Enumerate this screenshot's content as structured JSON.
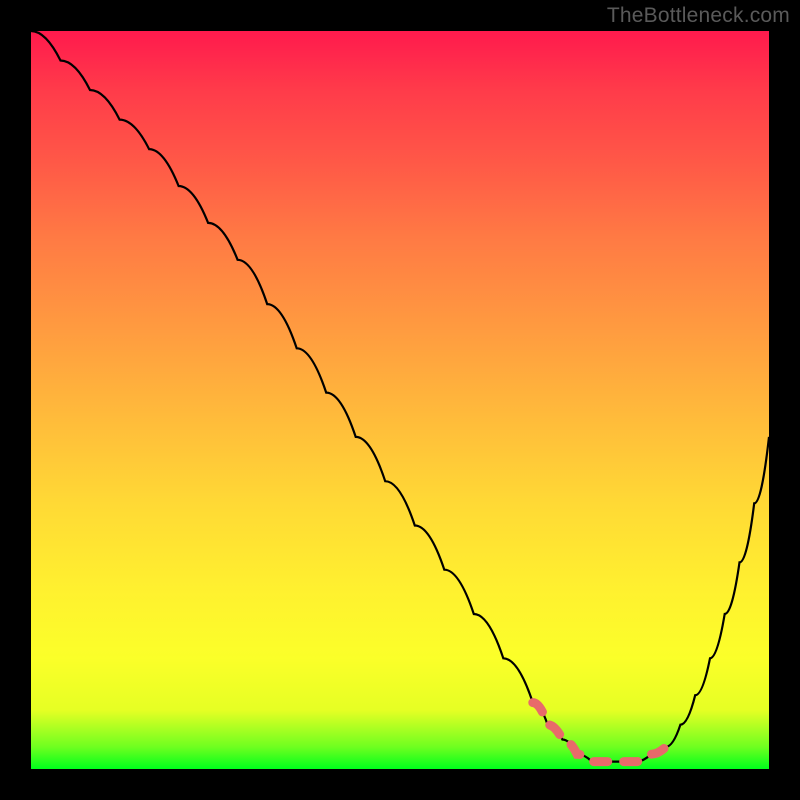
{
  "watermark": "TheBottleneck.com",
  "colors": {
    "frame_bg": "#000000",
    "curve_stroke": "#000000",
    "highlight_stroke": "#e86a6a",
    "gradient_top": "#ff1a4d",
    "gradient_bottom": "#00ff1c"
  },
  "chart_data": {
    "type": "line",
    "title": "",
    "xlabel": "",
    "ylabel": "",
    "xlim": [
      0,
      100
    ],
    "ylim": [
      0,
      100
    ],
    "description": "Bottleneck curve: high at left, descends to a flat minimum band around x≈70–85, then rises toward the right edge. Vertical axis reads as bottleneck percentage (top=high, bottom=0).",
    "series": [
      {
        "name": "bottleneck_pct",
        "x": [
          0,
          4,
          8,
          12,
          16,
          20,
          24,
          28,
          32,
          36,
          40,
          44,
          48,
          52,
          56,
          60,
          64,
          68,
          70,
          72,
          74,
          76,
          78,
          80,
          82,
          84,
          86,
          88,
          90,
          92,
          94,
          96,
          98,
          100
        ],
        "y": [
          100,
          96,
          92,
          88,
          84,
          79,
          74,
          69,
          63,
          57,
          51,
          45,
          39,
          33,
          27,
          21,
          15,
          9,
          6,
          4,
          2,
          1,
          1,
          1,
          1,
          2,
          3,
          6,
          10,
          15,
          21,
          28,
          36,
          45
        ]
      }
    ],
    "annotations": [
      {
        "name": "optimal_zone",
        "x_range": [
          68,
          86
        ],
        "note": "Dotted coral segment along curve near minimum"
      }
    ]
  }
}
